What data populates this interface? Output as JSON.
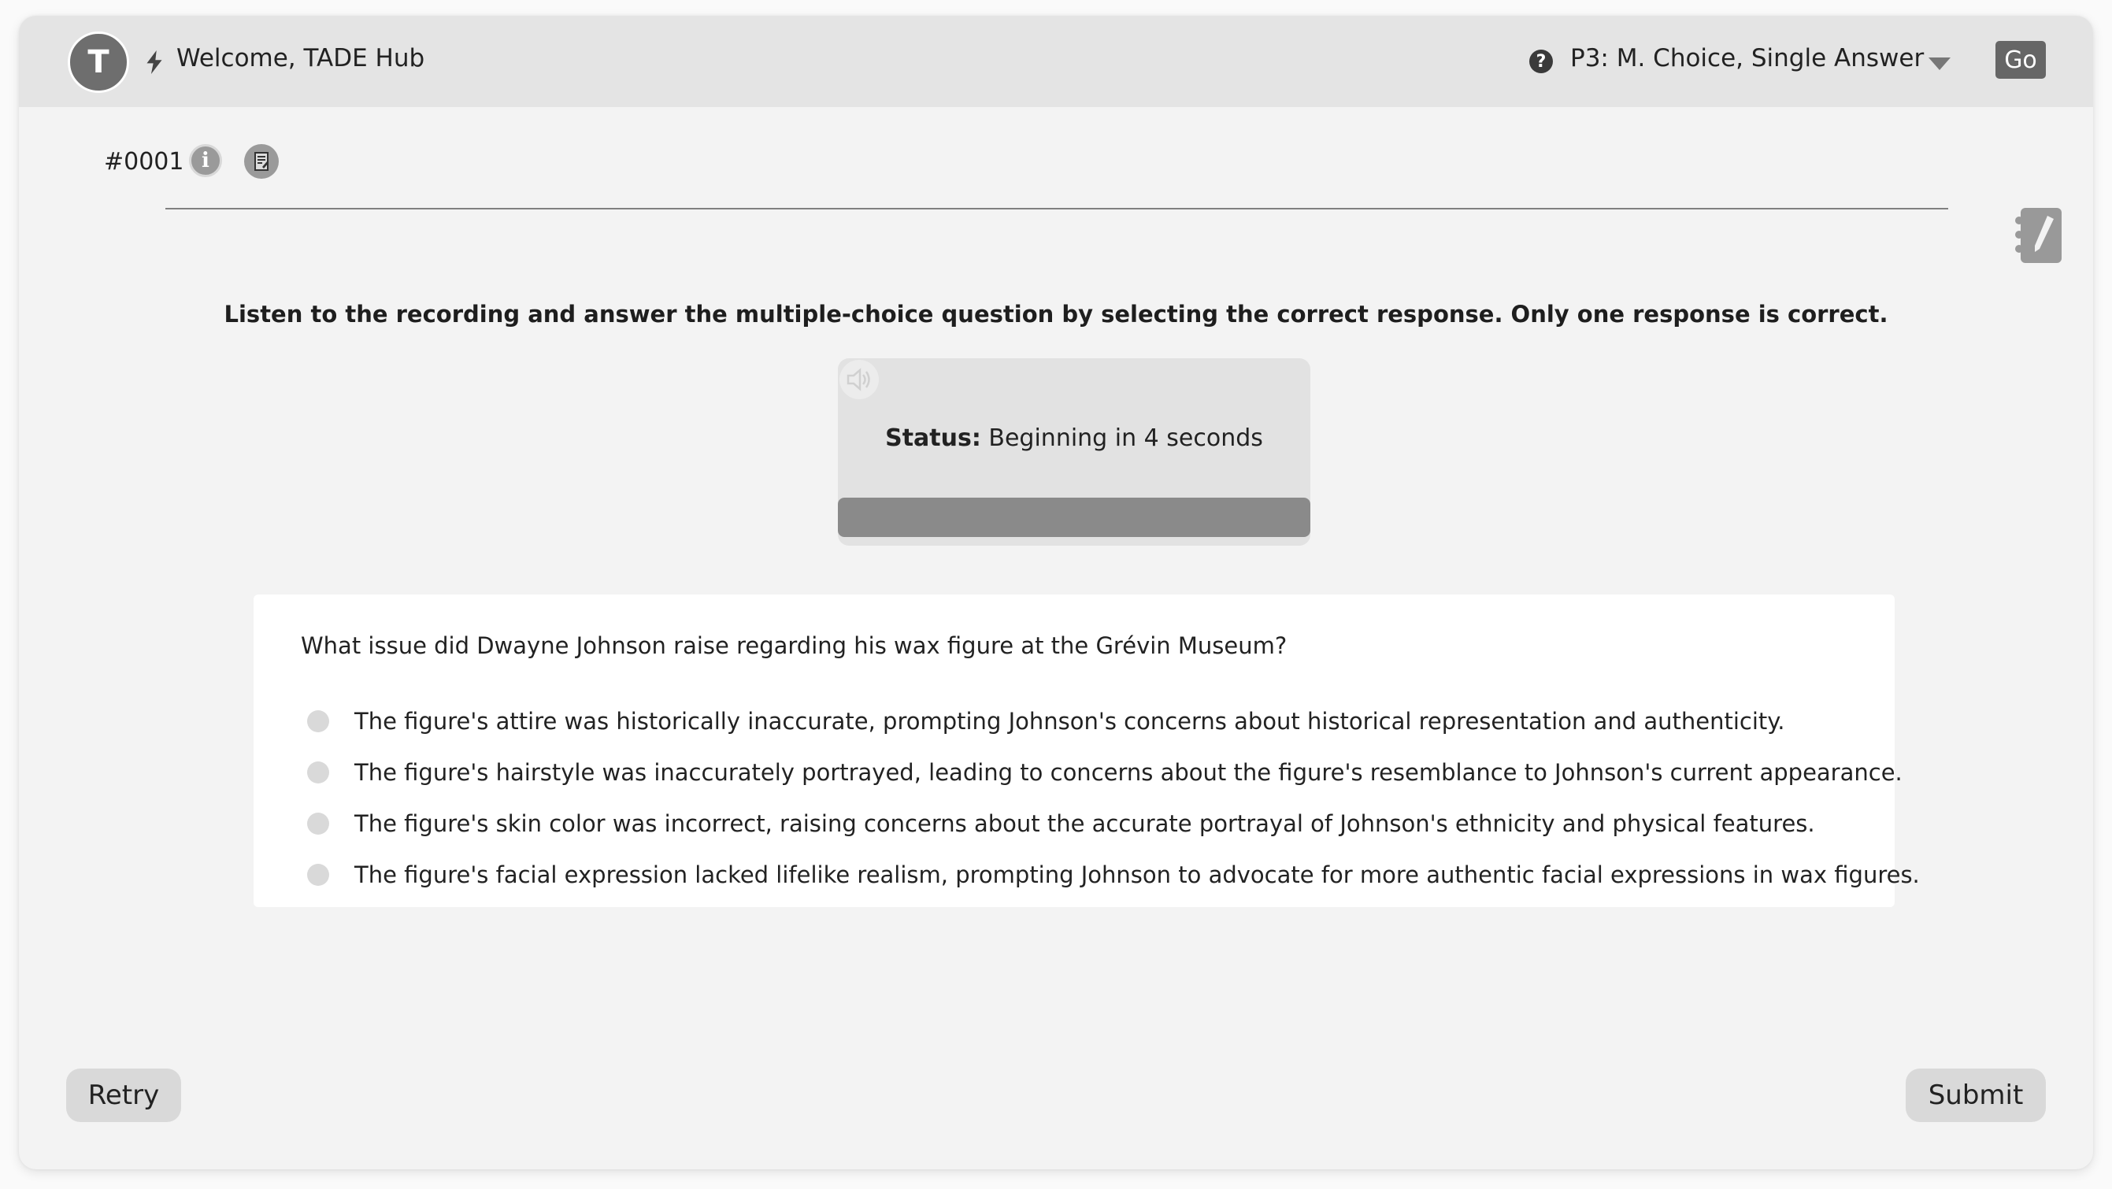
{
  "header": {
    "avatar_initial": "T",
    "welcome_text": "Welcome, TADE Hub",
    "section_select": "P3: M. Choice, Single Answer",
    "go_label": "Go"
  },
  "item": {
    "id": "#0001"
  },
  "instruction": "Listen to the recording and answer the multiple-choice question by selecting the correct response. Only one response is correct.",
  "player": {
    "status_label": "Status:",
    "status_value": "Beginning in 4 seconds",
    "progress_fraction": 1.0
  },
  "question": {
    "text": "What issue did Dwayne Johnson raise regarding his wax figure at the Grévin Museum?",
    "options": [
      {
        "label": "The figure's attire was historically inaccurate, prompting Johnson's concerns about historical representation and authenticity.",
        "selected": false
      },
      {
        "label": "The figure's hairstyle was inaccurately portrayed, leading to concerns about the figure's resemblance to Johnson's current appearance.",
        "selected": false
      },
      {
        "label": "The figure's skin color was incorrect, raising concerns about the accurate portrayal of Johnson's ethnicity and physical features.",
        "selected": false
      },
      {
        "label": "The figure's facial expression lacked lifelike realism, prompting Johnson to advocate for more authentic facial expressions in wax figures.",
        "selected": false
      }
    ]
  },
  "footer": {
    "retry_label": "Retry",
    "submit_label": "Submit"
  },
  "icons": {
    "bolt": "bolt-icon",
    "help": "question-circle-icon",
    "dropdown": "chevron-down-icon",
    "info": "info-icon",
    "notes": "notes-icon",
    "notepad": "notepad-pencil-icon",
    "speaker": "speaker-icon"
  }
}
